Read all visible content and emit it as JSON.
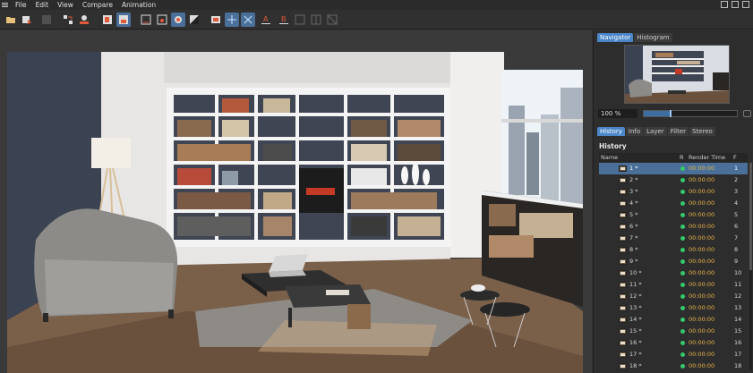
{
  "menubar": {
    "items": [
      "File",
      "Edit",
      "View",
      "Compare",
      "Animation"
    ]
  },
  "toolbar": {
    "tools": [
      {
        "name": "open-folder-icon",
        "active": false
      },
      {
        "name": "save-picture-icon",
        "active": false
      },
      {
        "name": "grid-icon",
        "active": false
      },
      {
        "name": "arrange-icon",
        "active": false
      },
      {
        "name": "render-user-icon",
        "active": false
      },
      {
        "name": "render-region-icon",
        "active": false
      },
      {
        "name": "render-view-icon",
        "active": true
      },
      {
        "name": "render-view-2-icon",
        "active": false
      },
      {
        "name": "render-teapot-icon",
        "active": true
      },
      {
        "name": "render-compare-icon",
        "active": false
      },
      {
        "name": "ab-compare-icon",
        "active": false
      },
      {
        "name": "split-horizontal-icon",
        "active": true
      },
      {
        "name": "split-vertical-icon",
        "active": true
      },
      {
        "name": "swap-a-icon",
        "active": false
      },
      {
        "name": "swap-b-icon",
        "active": false
      },
      {
        "name": "frame-a-icon",
        "active": false
      },
      {
        "name": "frame-b-icon",
        "active": false
      },
      {
        "name": "frame-c-icon",
        "active": false
      }
    ],
    "label_a": "A",
    "label_b": "B"
  },
  "navigator": {
    "tabs": [
      "Navigator",
      "Histogram"
    ],
    "active_tab": "Navigator",
    "zoom_value": "100 %",
    "zoom_fraction": 0.28
  },
  "panel": {
    "tabs": [
      "History",
      "Info",
      "Layer",
      "Filter",
      "Stereo"
    ],
    "active_tab": "History",
    "history_title": "History",
    "columns": {
      "name": "Name",
      "r": "R",
      "render_time": "Render Time",
      "f": "F"
    }
  },
  "history": [
    {
      "name": "1 *",
      "time": "00:00:00",
      "frame": "1",
      "selected": true
    },
    {
      "name": "2 *",
      "time": "00:00:00",
      "frame": "2",
      "selected": false
    },
    {
      "name": "3 *",
      "time": "00:00:00",
      "frame": "3",
      "selected": false
    },
    {
      "name": "4 *",
      "time": "00:00:00",
      "frame": "4",
      "selected": false
    },
    {
      "name": "5 *",
      "time": "00:00:00",
      "frame": "5",
      "selected": false
    },
    {
      "name": "6 *",
      "time": "00:00:00",
      "frame": "6",
      "selected": false
    },
    {
      "name": "7 *",
      "time": "00:00:00",
      "frame": "7",
      "selected": false
    },
    {
      "name": "8 *",
      "time": "00:00:00",
      "frame": "8",
      "selected": false
    },
    {
      "name": "9 *",
      "time": "00:00:00",
      "frame": "9",
      "selected": false
    },
    {
      "name": "10 *",
      "time": "00:00:00",
      "frame": "10",
      "selected": false
    },
    {
      "name": "11 *",
      "time": "00:00:00",
      "frame": "11",
      "selected": false
    },
    {
      "name": "12 *",
      "time": "00:00:00",
      "frame": "12",
      "selected": false
    },
    {
      "name": "13 *",
      "time": "00:00:00",
      "frame": "13",
      "selected": false
    },
    {
      "name": "14 *",
      "time": "00:00:00",
      "frame": "14",
      "selected": false
    },
    {
      "name": "15 *",
      "time": "00:00:00",
      "frame": "15",
      "selected": false
    },
    {
      "name": "16 *",
      "time": "00:00:00",
      "frame": "16",
      "selected": false
    },
    {
      "name": "17 *",
      "time": "00:00:00",
      "frame": "17",
      "selected": false
    },
    {
      "name": "18 *",
      "time": "00:00:00",
      "frame": "18",
      "selected": false
    }
  ],
  "colors": {
    "accent": "#4a86c8",
    "selected_row": "#4a6f99",
    "status_ok": "#34c96a",
    "time_text": "#e8b24a"
  }
}
